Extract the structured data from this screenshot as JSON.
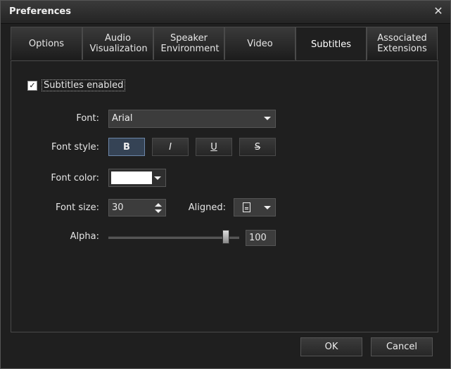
{
  "window": {
    "title": "Preferences",
    "close_glyph": "✕"
  },
  "tabs": [
    {
      "label": "Options"
    },
    {
      "label": "Audio Visualization"
    },
    {
      "label": "Speaker Environment"
    },
    {
      "label": "Video"
    },
    {
      "label": "Subtitles",
      "active": true
    },
    {
      "label": "Associated Extensions"
    }
  ],
  "subtitles": {
    "enabled_label": "Subtitles enabled",
    "enabled_checked": true,
    "font_label": "Font:",
    "font_value": "Arial",
    "style_label": "Font style:",
    "style_buttons": [
      "B",
      "I",
      "U",
      "S"
    ],
    "color_label": "Font color:",
    "color_value": "#ffffff",
    "size_label": "Font size:",
    "size_value": "30",
    "aligned_label": "Aligned:",
    "alpha_label": "Alpha:",
    "alpha_value": "100",
    "alpha_fraction": 0.9
  },
  "footer": {
    "ok_label": "OK",
    "cancel_label": "Cancel"
  },
  "colors": {
    "window_bg": "#1f1f1f",
    "accent_active_button": "#354355"
  }
}
